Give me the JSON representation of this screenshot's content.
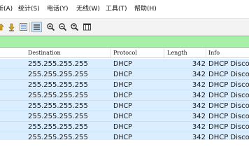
{
  "menu": [
    {
      "id": "capture",
      "label": "析(A)"
    },
    {
      "id": "statistics",
      "label": "统计(S)"
    },
    {
      "id": "telephony",
      "label": "电话(Y)"
    },
    {
      "id": "wireless",
      "label": "无线(W)"
    },
    {
      "id": "tools",
      "label": "工具(T)"
    },
    {
      "id": "help",
      "label": "帮助(H)"
    }
  ],
  "toolbar": {
    "icons": [
      "go-up-icon",
      "go-down-icon",
      "autoscroll-icon",
      "colorize-icon",
      "zoom-in-icon",
      "zoom-out-icon",
      "zoom-reset-icon",
      "resize-columns-icon"
    ],
    "active_icon": "colorize-icon"
  },
  "filter": {
    "value": "",
    "background": "#a8f0a8"
  },
  "columns": {
    "destination": "Destination",
    "protocol": "Protocol",
    "length": "Length",
    "info": "Info"
  },
  "rows": [
    {
      "destination": "255.255.255.255",
      "protocol": "DHCP",
      "length": "342",
      "info": "DHCP Disco"
    },
    {
      "destination": "255.255.255.255",
      "protocol": "DHCP",
      "length": "342",
      "info": "DHCP Disco"
    },
    {
      "destination": "255.255.255.255",
      "protocol": "DHCP",
      "length": "342",
      "info": "DHCP Disco"
    },
    {
      "destination": "255.255.255.255",
      "protocol": "DHCP",
      "length": "342",
      "info": "DHCP Disco"
    },
    {
      "destination": "255.255.255.255",
      "protocol": "DHCP",
      "length": "342",
      "info": "DHCP Disco"
    },
    {
      "destination": "255.255.255.255",
      "protocol": "DHCP",
      "length": "342",
      "info": "DHCP Disco"
    },
    {
      "destination": "255.255.255.255",
      "protocol": "DHCP",
      "length": "342",
      "info": "DHCP Disco"
    },
    {
      "destination": "255.255.255.255",
      "protocol": "DHCP",
      "length": "342",
      "info": "DHCP Disco"
    }
  ],
  "colors": {
    "row_background": "#daeeff",
    "filter_green": "#a8f0a8",
    "selection": "#cde4f7"
  }
}
